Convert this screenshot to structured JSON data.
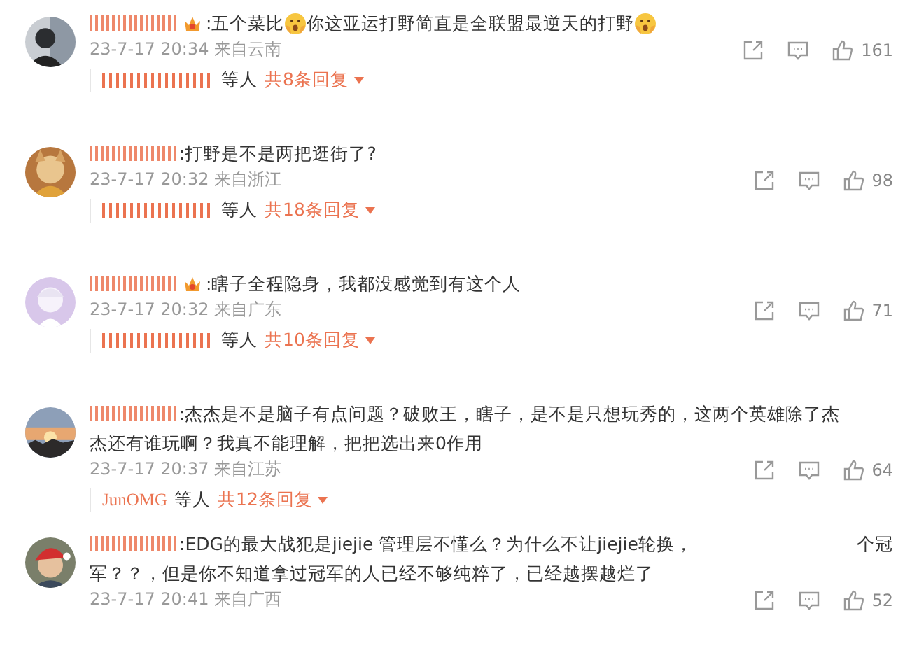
{
  "comments": [
    {
      "badge": true,
      "parts": [
        {
          "kind": "text",
          "text": ":五个菜比"
        },
        {
          "kind": "emoji"
        },
        {
          "kind": "text",
          "text": "你这亚运打野简直是全联盟最逆天的打野"
        },
        {
          "kind": "emoji"
        }
      ],
      "time": "23-7-17 20:34 来自云南",
      "likes": "161",
      "replies": {
        "names": [
          {
            "kind": "redacted"
          }
        ],
        "suffix": "等人",
        "count": "共8条回复"
      }
    },
    {
      "badge": false,
      "parts": [
        {
          "kind": "text",
          "text": ":打野是不是两把逛街了?"
        }
      ],
      "time": "23-7-17 20:32 来自浙江",
      "likes": "98",
      "replies": {
        "names": [
          {
            "kind": "redacted"
          }
        ],
        "suffix": "等人",
        "count": "共18条回复"
      }
    },
    {
      "badge": true,
      "parts": [
        {
          "kind": "text",
          "text": ":瞎子全程隐身，我都没感觉到有这个人"
        }
      ],
      "time": "23-7-17 20:32 来自广东",
      "likes": "71",
      "replies": {
        "names": [
          {
            "kind": "redacted"
          }
        ],
        "suffix": "等人",
        "count": "共10条回复"
      }
    },
    {
      "badge": false,
      "parts": [
        {
          "kind": "text",
          "text": ":杰杰是不是脑子有点问题？破败王，瞎子，是不是只想玩秀的，这两个英雄除了杰"
        },
        {
          "kind": "break"
        },
        {
          "kind": "text",
          "text": "杰还有谁玩啊？我真不能理解，把把选出来0作用"
        }
      ],
      "time": "23-7-17 20:37 来自江苏",
      "likes": "64",
      "replies": {
        "names": [
          {
            "kind": "text",
            "text": "JunOMG"
          }
        ],
        "suffix": "等人",
        "count": "共12条回复"
      }
    },
    {
      "badge": false,
      "parts": [
        {
          "kind": "text",
          "text": ":EDG的最大战犯是jiejie 管理层不懂么？为什么不让jiejie轮换，"
        },
        {
          "kind": "gap"
        },
        {
          "kind": "text",
          "text": "个冠"
        },
        {
          "kind": "break"
        },
        {
          "kind": "text",
          "text": "军？？，但是你不知道拿过冠军的人已经不够纯粹了，已经越摆越烂了"
        }
      ],
      "time": "23-7-17 20:41 来自广西",
      "likes": "52"
    }
  ]
}
